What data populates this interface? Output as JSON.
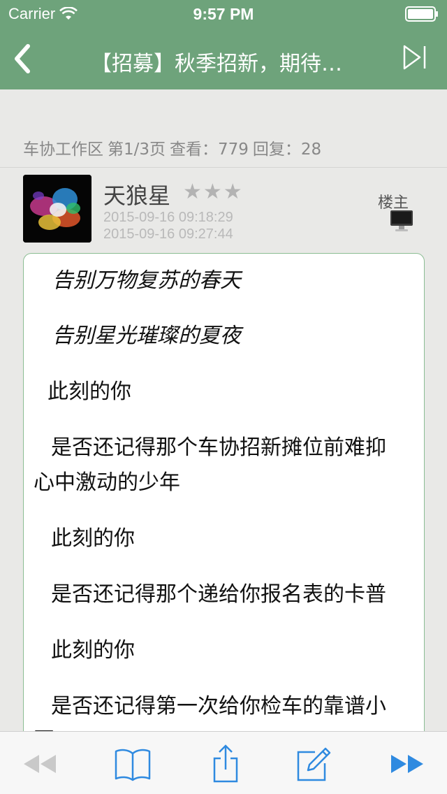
{
  "status": {
    "carrier": "Carrier",
    "time": "9:57 PM"
  },
  "nav": {
    "title": "【招募】秋季招新，期待…",
    "back_icon": "chevron-left-icon",
    "next_icon": "skip-forward-icon"
  },
  "thread": {
    "forum": "车协工作区",
    "page": "第1/3页",
    "views": "查看：779",
    "replies": "回复：28"
  },
  "post": {
    "username": "天狼星",
    "stars": "★★★",
    "posted_time": "2015-09-16 09:18:29",
    "edited_time": "2015-09-16 09:27:44",
    "floor": "楼主",
    "lines": [
      "告别万物复苏的春天",
      "告别星光璀璨的夏夜",
      "此刻的你",
      "是否还记得那个车协招新摊位前难抑",
      "心中激动的少年",
      "此刻的你",
      "是否还记得那个递给你报名表的卡普",
      "此刻的你",
      "是否还记得第一次给你检车的靠谱小",
      "哥"
    ]
  },
  "toolbar": {
    "items": [
      "rewind-icon",
      "book-icon",
      "share-icon",
      "compose-icon",
      "fast-forward-icon"
    ]
  },
  "colors": {
    "accent": "#6ea37b",
    "toolbar_icon": "#2f8ae0",
    "post_border": "#8bbd93"
  }
}
